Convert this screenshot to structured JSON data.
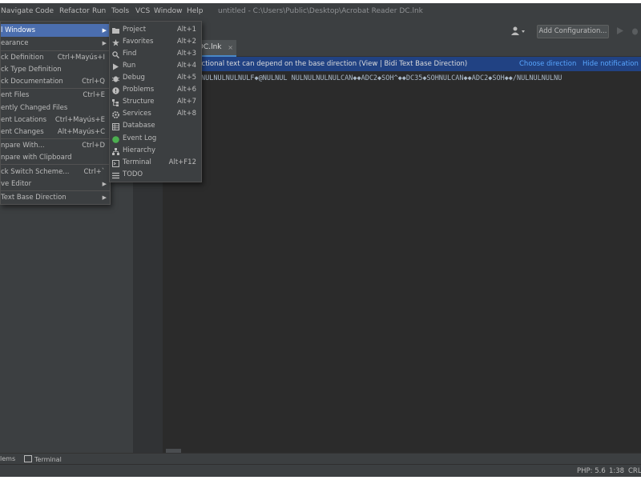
{
  "menubar": {
    "items": [
      "Navigate",
      "Code",
      "Refactor",
      "Run",
      "Tools",
      "VCS",
      "Window",
      "Help"
    ],
    "title": "untitled - C:\\Users\\Public\\Desktop\\Acrobat Reader DC.lnk"
  },
  "toolbar": {
    "add_config_label": "Add Configuration..."
  },
  "tab": {
    "label": "DC.lnk",
    "close": "×"
  },
  "notification": {
    "message": "rectional text can depend on the base direction (View | Bidi Text Base Direction)",
    "choose_link": "Choose direction",
    "hide_link": "Hide notification"
  },
  "editor": {
    "line1": "NULNULNULNULF◆@NULNUL  NULNULNULNULCAN◆◆ADC2◆SOH^◆◆DC35◆SOHNULCAN◆◆ADC2◆SOH◆◆/NULNULNULNU"
  },
  "menu_view": {
    "items": [
      {
        "label": "l Windows",
        "shortcut": "",
        "arrow": "▶",
        "selected": true
      },
      {
        "label": "earance",
        "shortcut": "",
        "arrow": "▶"
      },
      {
        "label": "ck Definition",
        "shortcut": "Ctrl+Mayús+I"
      },
      {
        "label": "ck Type Definition",
        "shortcut": ""
      },
      {
        "label": "ck Documentation",
        "shortcut": "Ctrl+Q"
      },
      {
        "label": "ent Files",
        "shortcut": "Ctrl+E"
      },
      {
        "label": "ently Changed Files",
        "shortcut": ""
      },
      {
        "label": "ent Locations",
        "shortcut": "Ctrl+Mayús+E"
      },
      {
        "label": "ent Changes",
        "shortcut": "Alt+Mayús+C"
      },
      {
        "label": "npare With...",
        "shortcut": "Ctrl+D"
      },
      {
        "label": "npare with Clipboard",
        "shortcut": ""
      },
      {
        "label": "ck Switch Scheme...",
        "shortcut": "Ctrl+`"
      },
      {
        "label": "ve Editor",
        "shortcut": "",
        "arrow": "▶"
      },
      {
        "label": " Text Base Direction",
        "shortcut": "",
        "arrow": "▶"
      }
    ]
  },
  "menu_tool_windows": {
    "items": [
      {
        "label": "Project",
        "shortcut": "Alt+1",
        "icon": "folder-icon"
      },
      {
        "label": "Favorites",
        "shortcut": "Alt+2",
        "icon": "star-icon"
      },
      {
        "label": "Find",
        "shortcut": "Alt+3",
        "icon": "search-icon"
      },
      {
        "label": "Run",
        "shortcut": "Alt+4",
        "icon": "play-icon"
      },
      {
        "label": "Debug",
        "shortcut": "Alt+5",
        "icon": "bug-icon"
      },
      {
        "label": "Problems",
        "shortcut": "Alt+6",
        "icon": "warning-icon"
      },
      {
        "label": "Structure",
        "shortcut": "Alt+7",
        "icon": "structure-icon"
      },
      {
        "label": "Services",
        "shortcut": "Alt+8",
        "icon": "services-icon"
      },
      {
        "label": "Database",
        "shortcut": "",
        "icon": "database-icon"
      },
      {
        "label": "Event Log",
        "shortcut": "",
        "icon": "event-log-icon"
      },
      {
        "label": "Hierarchy",
        "shortcut": "",
        "icon": "hierarchy-icon"
      },
      {
        "label": "Terminal",
        "shortcut": "Alt+F12",
        "icon": "terminal-icon"
      },
      {
        "label": "TODO",
        "shortcut": "",
        "icon": "todo-icon"
      }
    ]
  },
  "bottom_tools": {
    "problems": "lems",
    "terminal": "Terminal"
  },
  "status": {
    "php": "PHP: 5.6",
    "position": "1:38",
    "crlf": "CRL"
  },
  "colors": {
    "accent": "#4b6eaf",
    "notification_bg": "#214283",
    "editor_bg": "#2b2b2b",
    "panel_bg": "#3c3f41"
  }
}
